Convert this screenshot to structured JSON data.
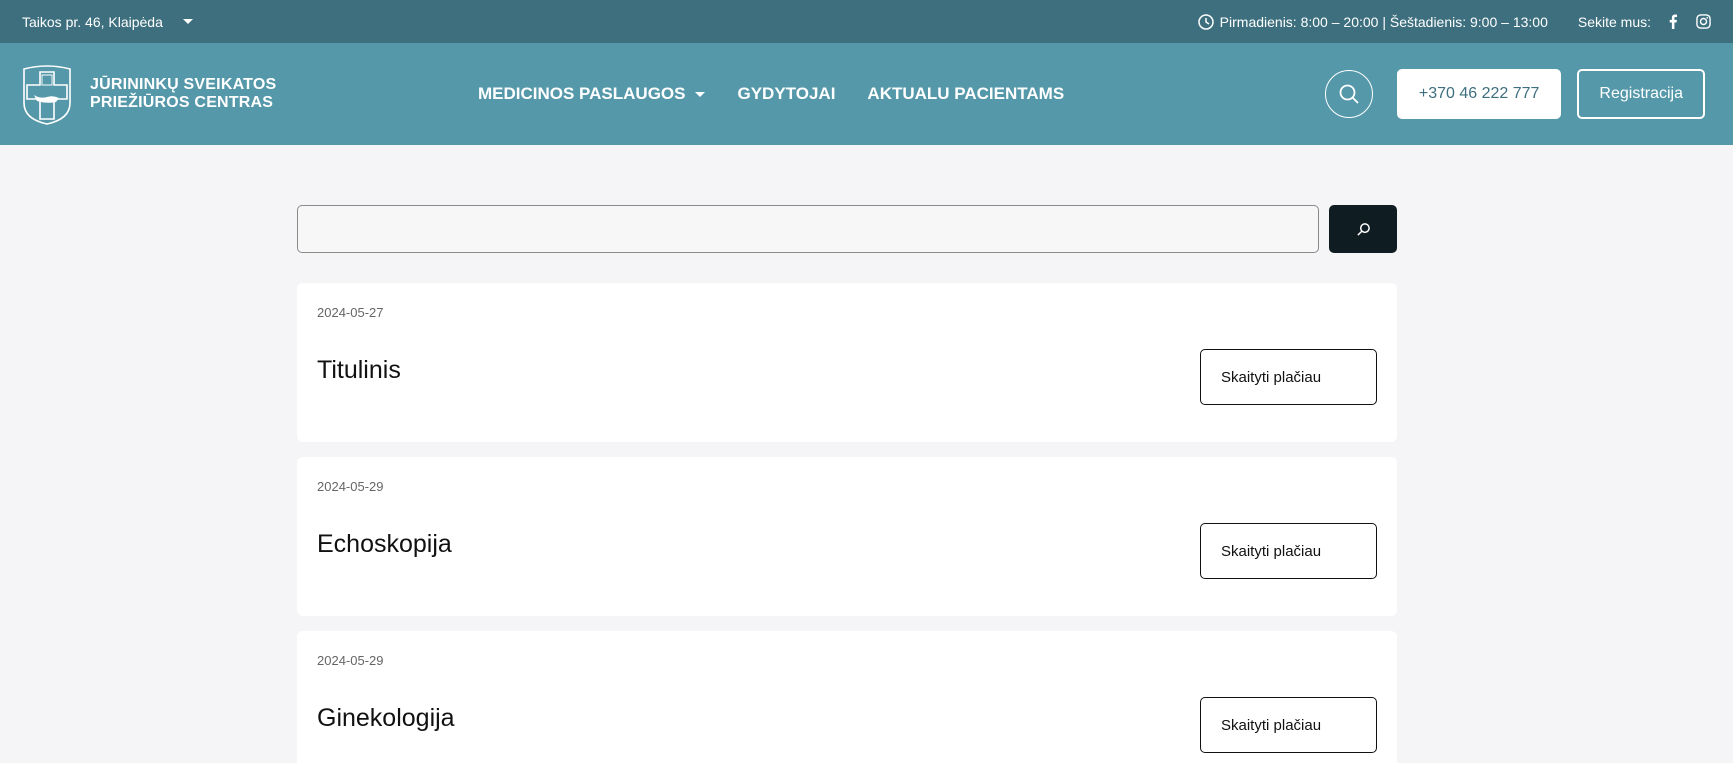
{
  "topbar": {
    "address": "Taikos pr. 46, Klaipėda",
    "hours": "Pirmadienis: 8:00 – 20:00 | Šeštadienis: 9:00 – 13:00",
    "follow_label": "Sekite mus:"
  },
  "header": {
    "logo_line1": "JŪRININKŲ SVEIKATOS",
    "logo_line2": "PRIEŽIŪROS CENTRAS",
    "nav": [
      {
        "label": "MEDICINOS PASLAUGOS"
      },
      {
        "label": "GYDYTOJAI"
      },
      {
        "label": "AKTUALU PACIENTAMS"
      }
    ],
    "phone": "+370 46 222 777",
    "register": "Registracija"
  },
  "search": {
    "value": "",
    "placeholder": ""
  },
  "results": [
    {
      "date": "2024-05-27",
      "title": "Titulinis",
      "button": "Skaityti plačiau"
    },
    {
      "date": "2024-05-29",
      "title": "Echoskopija",
      "button": "Skaityti plačiau"
    },
    {
      "date": "2024-05-29",
      "title": "Ginekologija",
      "button": "Skaityti plačiau"
    }
  ],
  "colors": {
    "topbar": "#3d6f7f",
    "header": "#5598aa",
    "search_button": "#0f1c21",
    "background": "#f5f5f7"
  }
}
